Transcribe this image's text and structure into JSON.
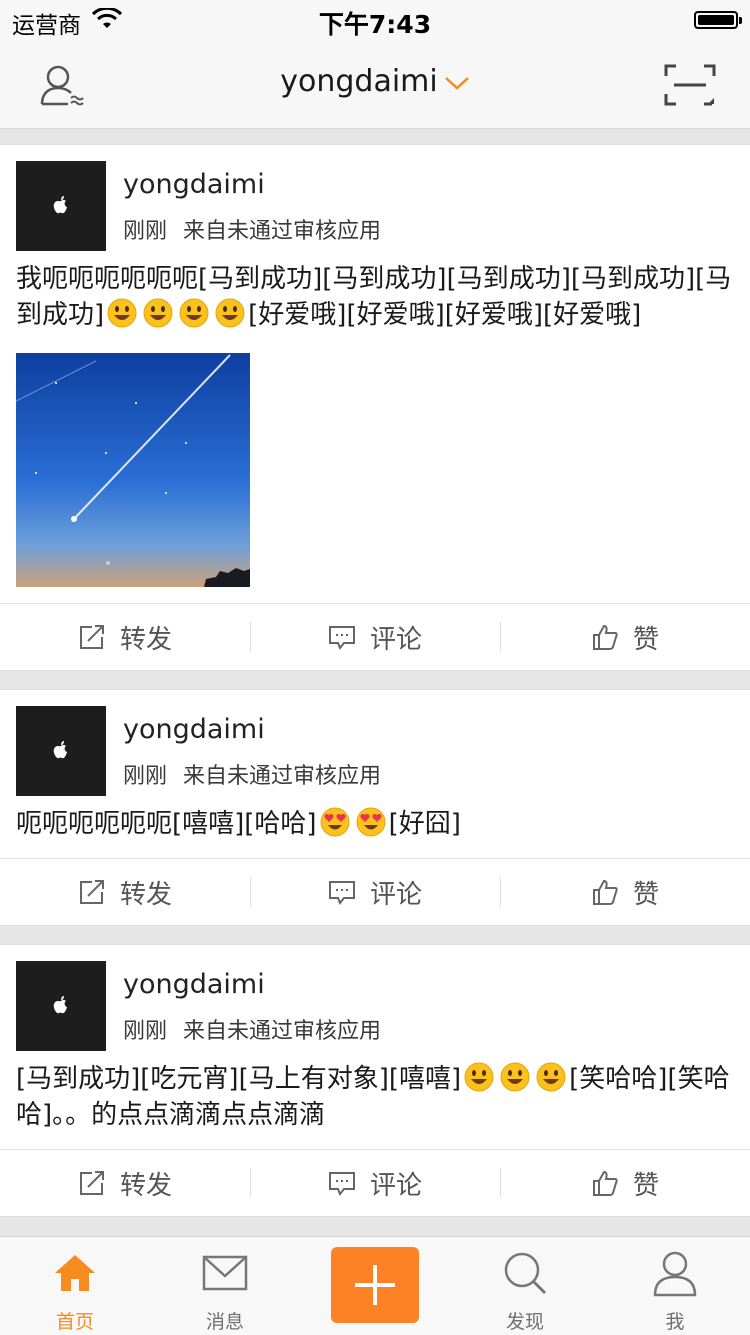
{
  "status_bar": {
    "carrier": "运营商",
    "time": "下午7:43"
  },
  "nav": {
    "title": "yongdaimi"
  },
  "posts": [
    {
      "username": "yongdaimi",
      "time": "刚刚",
      "source": "来自未通过审核应用",
      "text_parts": [
        {
          "t": "text",
          "v": "我呃呃呃呃呃呃[马到成功][马到成功][马到成功][马到成功][马到成功]"
        },
        {
          "t": "emoji",
          "v": "smiley"
        },
        {
          "t": "emoji",
          "v": "smiley"
        },
        {
          "t": "emoji",
          "v": "smiley"
        },
        {
          "t": "emoji",
          "v": "smiley"
        },
        {
          "t": "text",
          "v": "[好爱哦][好爱哦][好爱哦][好爱哦]"
        }
      ],
      "has_photo": true,
      "photo": "night-sky-meteor"
    },
    {
      "username": "yongdaimi",
      "time": "刚刚",
      "source": "来自未通过审核应用",
      "text_parts": [
        {
          "t": "text",
          "v": "呃呃呃呃呃呃[嘻嘻][哈哈]"
        },
        {
          "t": "emoji",
          "v": "heart-eyes"
        },
        {
          "t": "emoji",
          "v": "heart-eyes"
        },
        {
          "t": "text",
          "v": "[好囧]"
        }
      ],
      "has_photo": false
    },
    {
      "username": "yongdaimi",
      "time": "刚刚",
      "source": "来自未通过审核应用",
      "text_parts": [
        {
          "t": "text",
          "v": "[马到成功][吃元宵][马上有对象][嘻嘻]"
        },
        {
          "t": "emoji",
          "v": "smiley"
        },
        {
          "t": "emoji",
          "v": "smiley"
        },
        {
          "t": "emoji",
          "v": "smiley"
        },
        {
          "t": "text",
          "v": "[笑哈哈][笑哈哈]。。的点点滴滴点点滴滴"
        }
      ],
      "has_photo": false
    }
  ],
  "actions": {
    "repost": "转发",
    "comment": "评论",
    "like": "赞"
  },
  "tabs": [
    {
      "label": "首页",
      "icon": "home-icon",
      "active": true
    },
    {
      "label": "消息",
      "icon": "envelope-icon",
      "active": false
    },
    {
      "label": "",
      "icon": "plus-icon",
      "active": false
    },
    {
      "label": "发现",
      "icon": "search-icon",
      "active": false
    },
    {
      "label": "我",
      "icon": "profile-icon",
      "active": false
    }
  ],
  "colors": {
    "accent": "#f68b1f",
    "compose_button": "#fd8225",
    "avatar_bg": "#1d1d1d",
    "background": "#e6e6e6"
  }
}
